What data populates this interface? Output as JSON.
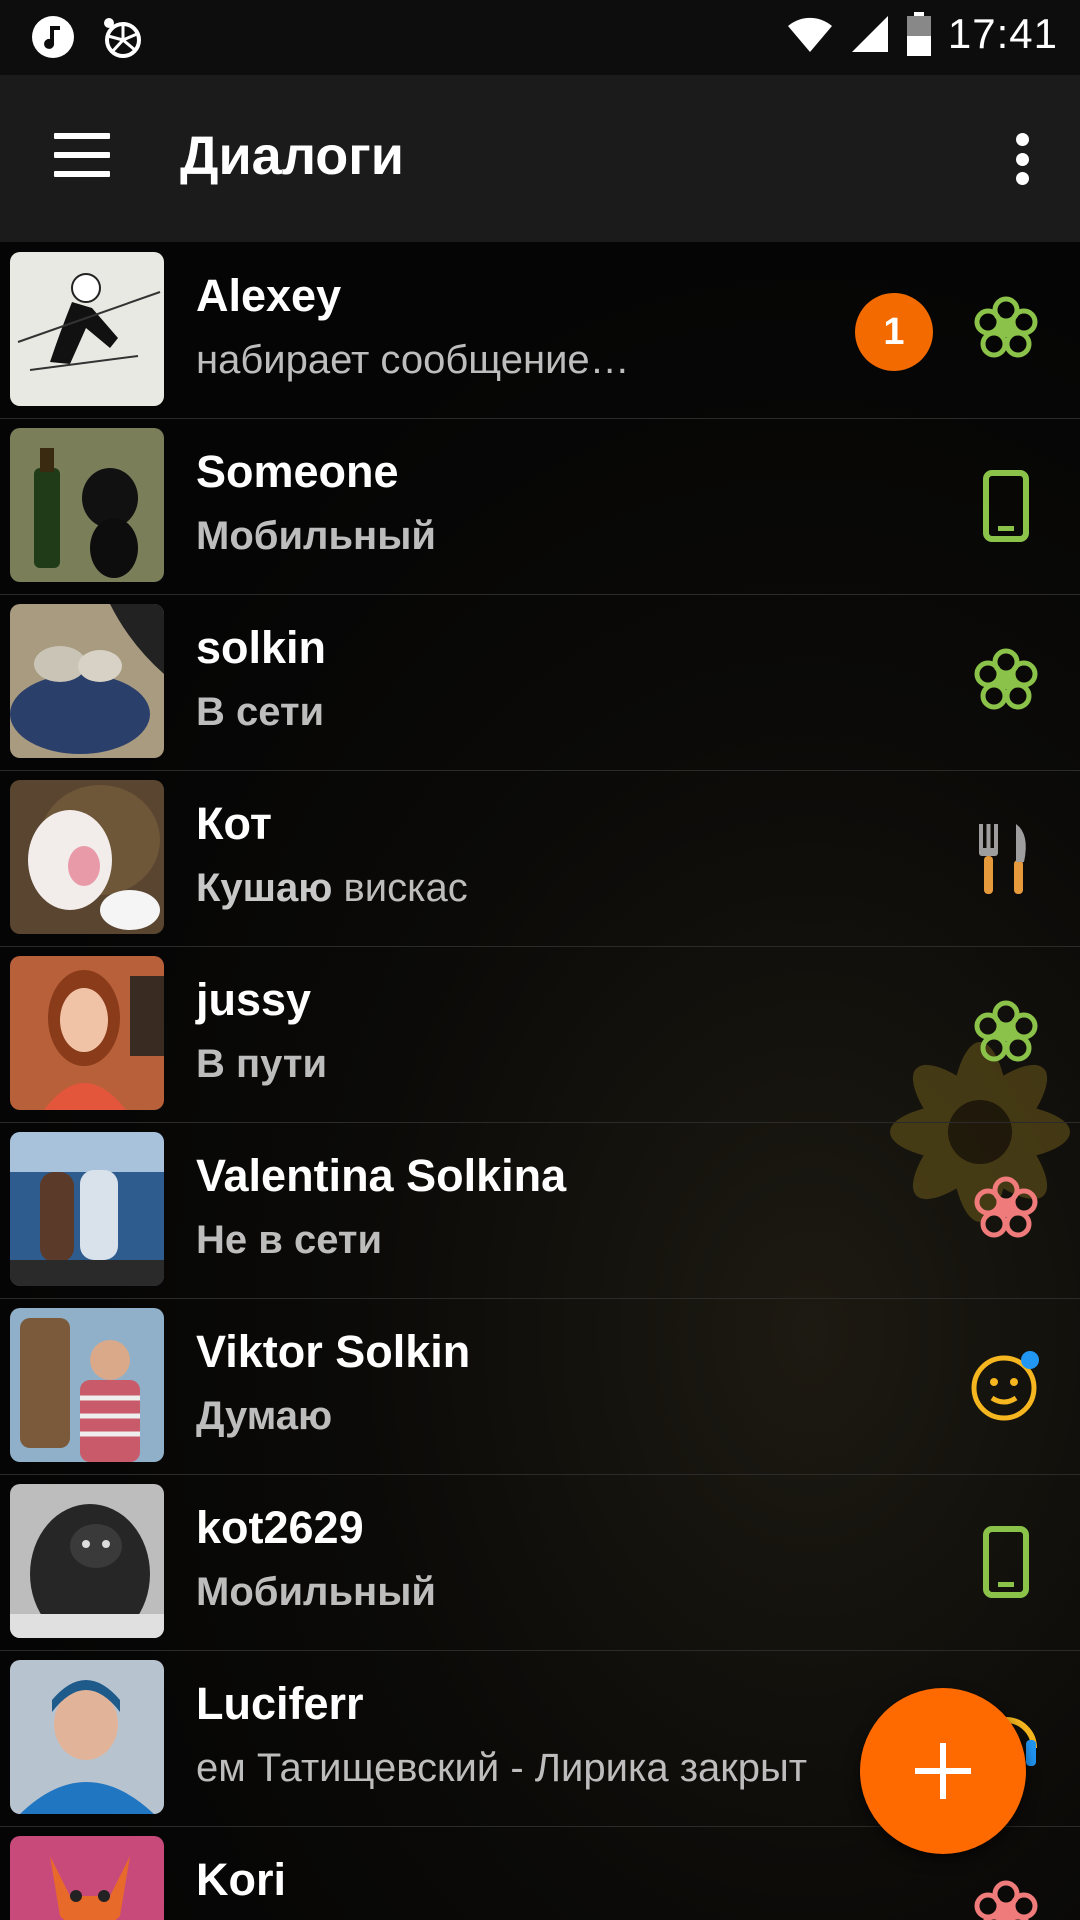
{
  "statusbar": {
    "time": "17:41",
    "left_icons": [
      "music-note-icon",
      "lemon-icon"
    ],
    "right_icons": [
      "wifi-icon",
      "signal-icon",
      "battery-icon"
    ]
  },
  "toolbar": {
    "title": "Диалоги",
    "menu_icon": "hamburger-menu-icon",
    "more_icon": "more-vertical-icon"
  },
  "contacts": [
    {
      "name": "Alexey",
      "status": "набирает сообщение…",
      "badge": "1",
      "icon": "flower-online-icon",
      "icon_color": "#8bc34a"
    },
    {
      "name": "Someone",
      "status": "Мобильный",
      "icon": "mobile-phone-icon",
      "icon_color": "#8bc34a"
    },
    {
      "name": "solkin",
      "status": "В сети",
      "icon": "flower-online-icon",
      "icon_color": "#8bc34a"
    },
    {
      "name": "Кот",
      "status_bold": "Кушаю",
      "status_rest": " вискас",
      "icon": "fork-knife-icon",
      "icon_color": "#e69a3c"
    },
    {
      "name": "jussy",
      "status": "В пути",
      "icon": "flower-online-icon",
      "icon_color": "#8bc34a"
    },
    {
      "name": "Valentina Solkina",
      "status": "Не в сети",
      "icon": "flower-offline-icon",
      "icon_color": "#f07b7b"
    },
    {
      "name": "Viktor Solkin",
      "status": "Думаю",
      "icon": "thinking-face-icon",
      "icon_color": "#f5b61f"
    },
    {
      "name": "kot2629",
      "status": "Мобильный",
      "icon": "mobile-phone-icon",
      "icon_color": "#8bc34a"
    },
    {
      "name": "Luciferr",
      "status": "ем Татищевский - Лирика закрыт",
      "icon": "headphones-icon",
      "icon_color": "#f5b61f"
    },
    {
      "name": "Kori",
      "status": "",
      "icon": "flower-offline-icon",
      "icon_color": "#f07b7b"
    }
  ],
  "fab": {
    "icon": "plus-icon"
  }
}
